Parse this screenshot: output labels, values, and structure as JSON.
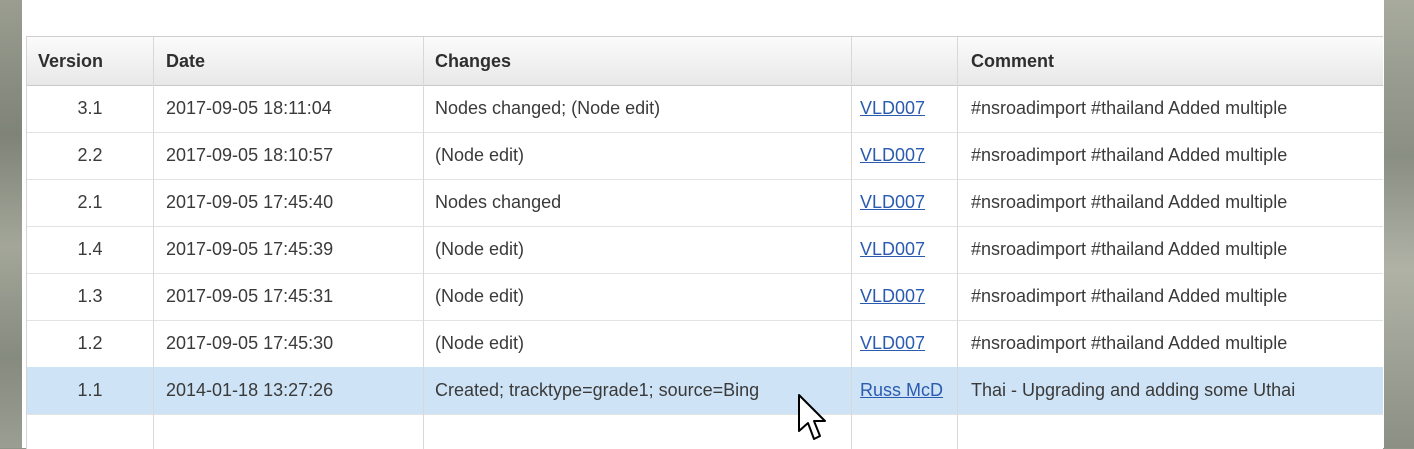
{
  "table": {
    "columns": [
      "Version",
      "Date",
      "Changes",
      "",
      "Comment"
    ],
    "rows": [
      {
        "version": "3.1",
        "date": "2017-09-05 18:11:04",
        "changes": "Nodes changed; (Node edit)",
        "user": "VLD007",
        "comment": "#nsroadimport #thailand Added multiple"
      },
      {
        "version": "2.2",
        "date": "2017-09-05 18:10:57",
        "changes": "(Node edit)",
        "user": "VLD007",
        "comment": "#nsroadimport #thailand Added multiple"
      },
      {
        "version": "2.1",
        "date": "2017-09-05 17:45:40",
        "changes": "Nodes changed",
        "user": "VLD007",
        "comment": "#nsroadimport #thailand Added multiple"
      },
      {
        "version": "1.4",
        "date": "2017-09-05 17:45:39",
        "changes": "(Node edit)",
        "user": "VLD007",
        "comment": "#nsroadimport #thailand Added multiple"
      },
      {
        "version": "1.3",
        "date": "2017-09-05 17:45:31",
        "changes": "(Node edit)",
        "user": "VLD007",
        "comment": "#nsroadimport #thailand Added multiple"
      },
      {
        "version": "1.2",
        "date": "2017-09-05 17:45:30",
        "changes": "(Node edit)",
        "user": "VLD007",
        "comment": "#nsroadimport #thailand Added multiple"
      },
      {
        "version": "1.1",
        "date": "2014-01-18 13:27:26",
        "changes": "Created; tracktype=grade1; source=Bing",
        "user": "Russ McD",
        "comment": "Thai - Upgrading and adding some Uthai",
        "selected": true
      }
    ]
  },
  "colors": {
    "selected_row": "#cfe3f6",
    "link": "#2a5bb0",
    "header_bg": "#ececec"
  },
  "icons": {
    "cursor": "arrow-pointer"
  }
}
